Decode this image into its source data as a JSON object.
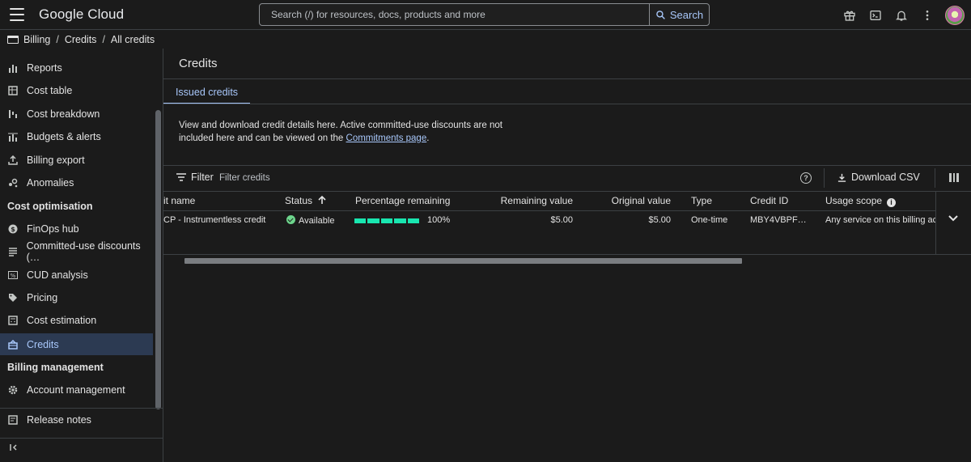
{
  "topbar": {
    "logo": "Google Cloud",
    "search_placeholder": "Search (/) for resources, docs, products and more",
    "search_button": "Search",
    "icons": [
      "gift-icon",
      "terminal-icon",
      "bell-icon",
      "more-vert-icon",
      "avatar"
    ]
  },
  "breadcrumb": {
    "items": [
      "Billing",
      "Credits",
      "All credits"
    ]
  },
  "sidebar": {
    "items": [
      {
        "label": "Reports",
        "icon": "bar-chart-icon"
      },
      {
        "label": "Cost table",
        "icon": "table-icon"
      },
      {
        "label": "Cost breakdown",
        "icon": "waterfall-icon"
      },
      {
        "label": "Budgets & alerts",
        "icon": "budget-icon"
      },
      {
        "label": "Billing export",
        "icon": "export-icon"
      },
      {
        "label": "Anomalies",
        "icon": "anomaly-icon"
      }
    ],
    "section_cost_optimisation": "Cost optimisation",
    "optimisation_items": [
      {
        "label": "FinOps hub",
        "icon": "dollar-icon"
      },
      {
        "label": "Committed-use discounts (…",
        "icon": "list-icon"
      },
      {
        "label": "CUD analysis",
        "icon": "percent-icon"
      },
      {
        "label": "Pricing",
        "icon": "tag-icon"
      },
      {
        "label": "Cost estimation",
        "icon": "calculator-icon"
      },
      {
        "label": "Credits",
        "icon": "credits-icon",
        "active": true
      }
    ],
    "section_billing_management": "Billing management",
    "management_items": [
      {
        "label": "Account management",
        "icon": "gear-icon"
      }
    ],
    "release_notes": "Release notes",
    "collapse_icon": "collapse-icon"
  },
  "main": {
    "title": "Credits",
    "tab": "Issued credits",
    "description_before_link": "View and download credit details here. Active committed-use discounts are not included here and can be viewed on the ",
    "description_link": "Commitments page",
    "description_after_link": ".",
    "filter_label": "Filter",
    "filter_placeholder": "Filter credits",
    "download_label": "Download CSV"
  },
  "table": {
    "columns": {
      "credit_name": "it name",
      "status": "Status",
      "percentage_remaining": "Percentage remaining",
      "remaining_value": "Remaining value",
      "original_value": "Original value",
      "type": "Type",
      "credit_id": "Credit ID",
      "usage_scope": "Usage scope"
    },
    "rows": [
      {
        "credit_name": "CP - Instrumentless credit",
        "status": "Available",
        "percentage_remaining": "100%",
        "percentage_value": 1.0,
        "remaining_value": "$5.00",
        "original_value": "$5.00",
        "type": "One-time",
        "credit_id": "MBY4VBPF…",
        "usage_scope": "Any service on this billing ac"
      }
    ]
  },
  "colors": {
    "accent": "#a8c7fa",
    "background": "#1b1b1b",
    "progress": "#19e6b0",
    "status_ok": "#6dd58c",
    "active_nav": "#2c3a52"
  }
}
